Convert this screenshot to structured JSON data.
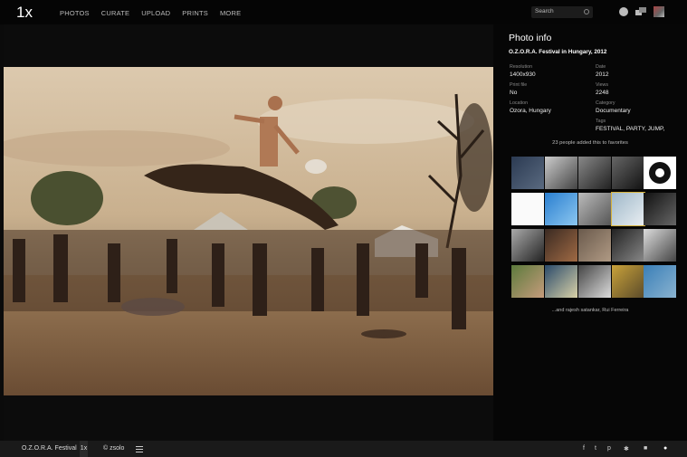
{
  "topbar": {
    "logo": "1x",
    "nav": [
      "PHOTOS",
      "CURATE",
      "UPLOAD",
      "PRINTS",
      "MORE"
    ],
    "search_placeholder": "Search"
  },
  "panel": {
    "title": "Photo info",
    "photo_title": "O.Z.O.R.A. Festival in Hungary, 2012",
    "fields": {
      "resolution_label": "Resolution",
      "resolution": "1400x930",
      "date_label": "Date",
      "date": "2012",
      "print_label": "Print file",
      "print": "No",
      "views_label": "Views",
      "views": "2248",
      "location_label": "Location",
      "location": "Ozora, Hungary",
      "category_label": "Category",
      "category": "Documentary",
      "tags_label": "Tags",
      "tags": "FESTIVAL, PARTY, JUMP,"
    },
    "favorites_text": "23 people added this to favorites",
    "favorites_names": "...and rajesh satankar, Rui Ferreira"
  },
  "bottombar": {
    "title": "O.Z.O.R.A. Festival",
    "tag": "1x",
    "author": "© zsolo"
  },
  "colors": {
    "accent_selected": "#d7b33b",
    "background": "#0b0b0b"
  }
}
